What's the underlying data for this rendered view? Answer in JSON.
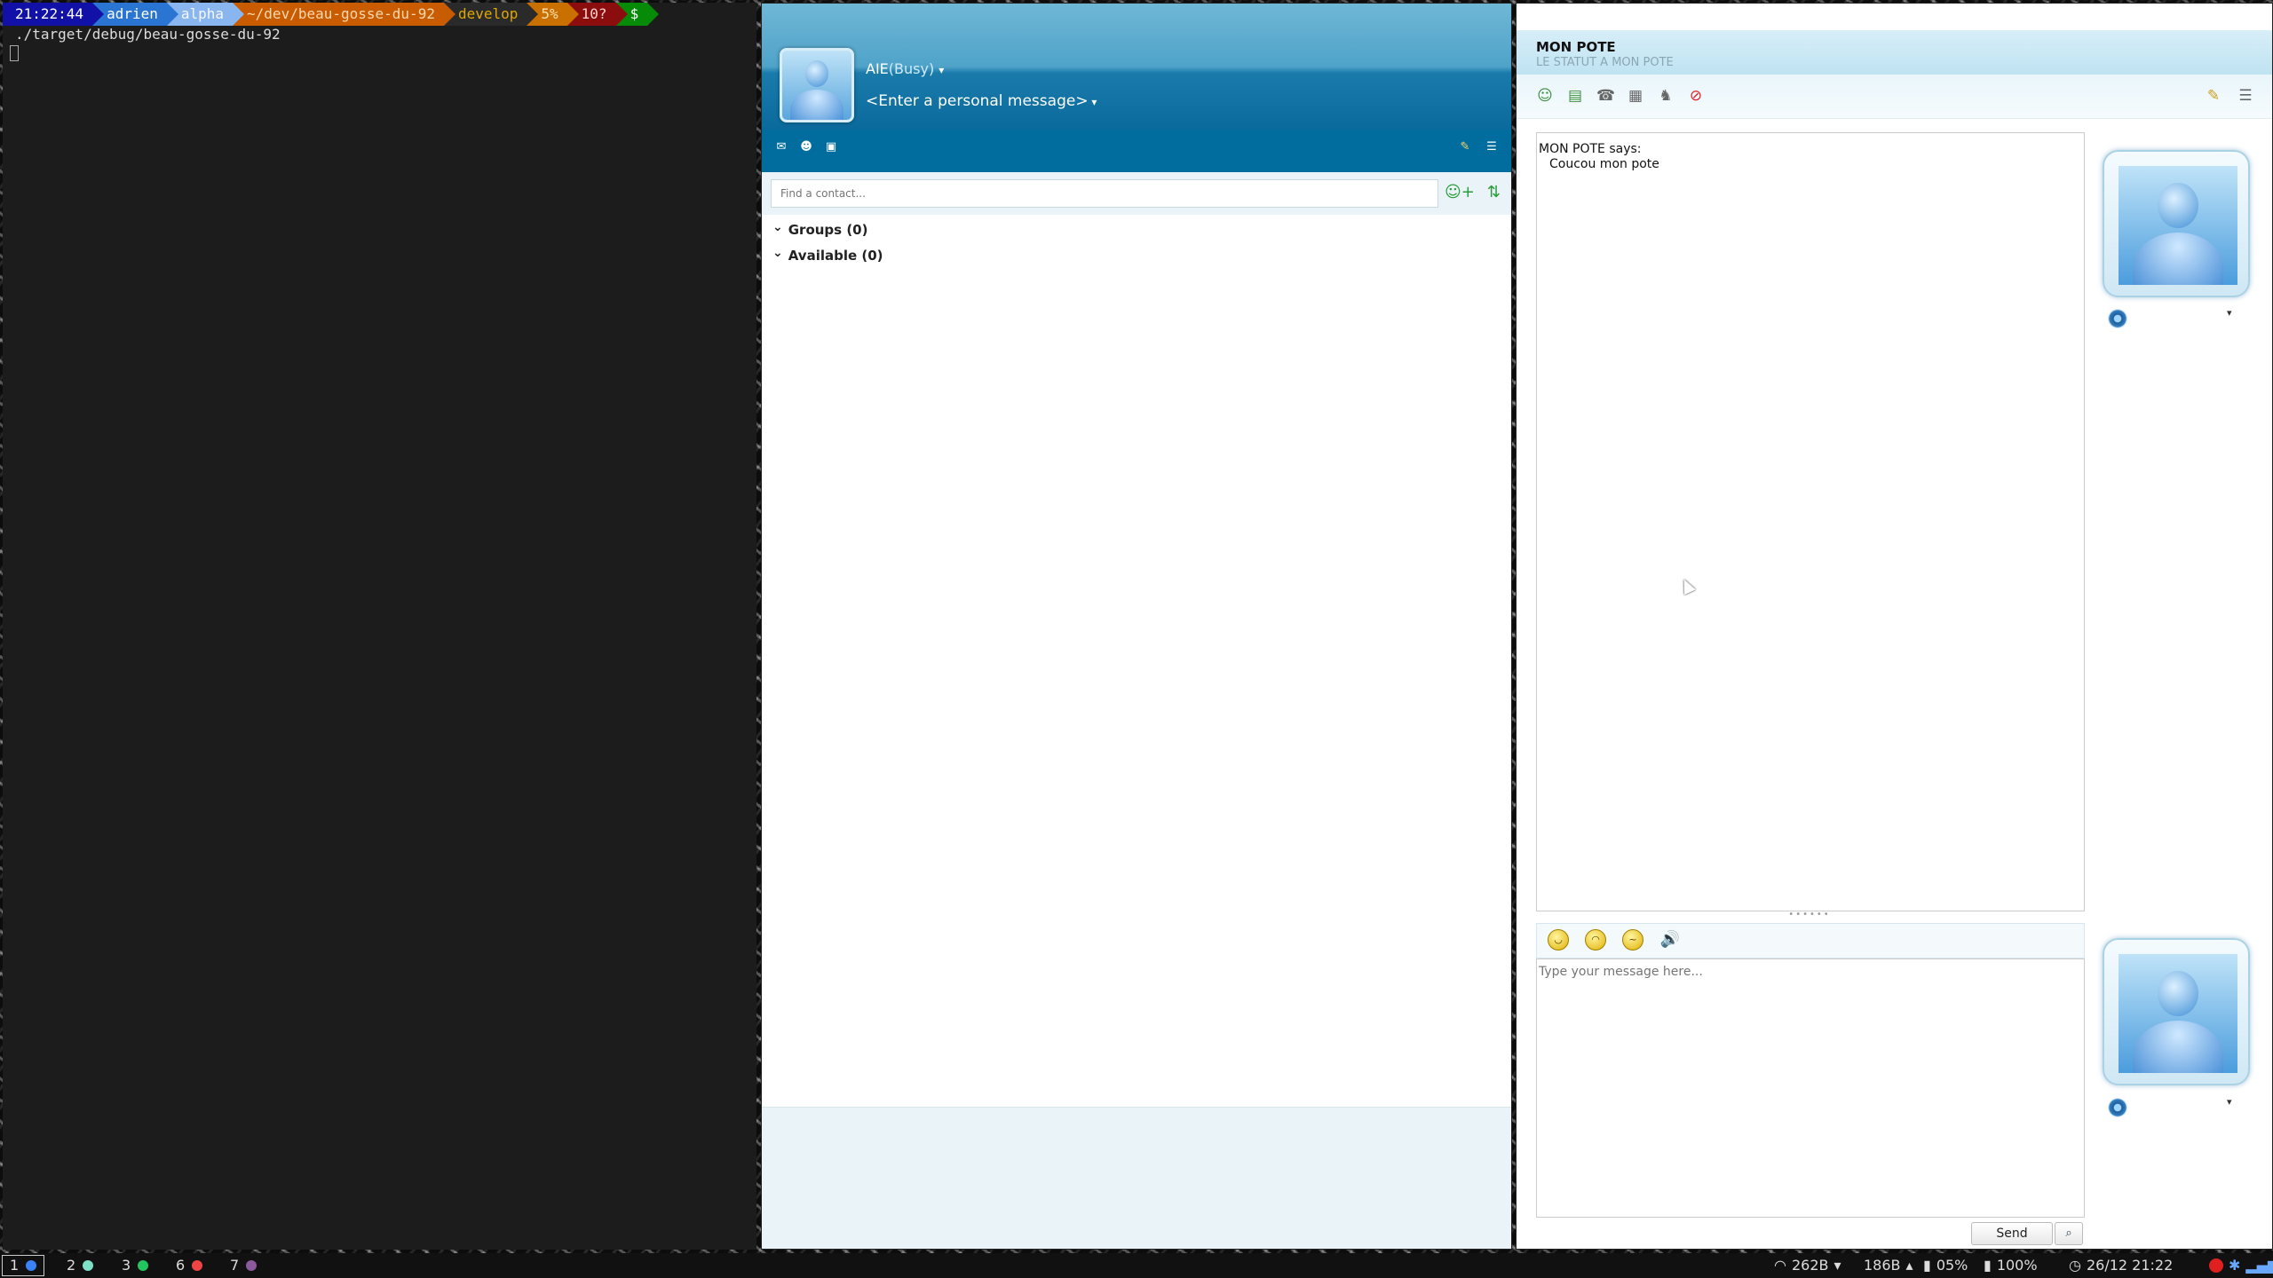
{
  "terminal": {
    "prompt": {
      "time": "21:22:44",
      "user": "adrien",
      "host": "alpha",
      "path": "~/dev/beau-gosse-du-92",
      "branch": "develop",
      "percent": "5%",
      "untracked": "10?",
      "symbol": "$"
    },
    "output_line": "./target/debug/beau-gosse-du-92"
  },
  "contacts": {
    "display_name": "AIE",
    "status": "(Busy)",
    "personal_message": "<Enter a personal message>",
    "search_placeholder": "Find a contact...",
    "groups": [
      {
        "label": "Groups (0)"
      },
      {
        "label": "Available (0)"
      }
    ],
    "toolbar_icons": [
      "mail-icon",
      "contacts-icon",
      "inbox-icon"
    ],
    "toolbar_right_icons": [
      "paintbrush-icon",
      "menu-icon"
    ],
    "search_buttons": [
      "add-contact-icon",
      "sort-icon"
    ]
  },
  "chat": {
    "contact_name": "MON POTE",
    "contact_status": "LE STATUT A MON POTE",
    "history": [
      {
        "sender_line": "MON POTE says:",
        "text": "Coucou mon pote"
      }
    ],
    "compose_placeholder": "Type your message here...",
    "send_label": "Send",
    "toolbar_icons": [
      "invite-icon",
      "share-file-icon",
      "call-icon",
      "video-icon",
      "games-icon",
      "block-icon"
    ],
    "toolbar_right_icons": [
      "paintbrush-icon",
      "menu-icon"
    ],
    "emoticons": [
      "smile-icon",
      "wink-icon",
      "nudge-icon",
      "sound-icon"
    ]
  },
  "taskbar": {
    "workspaces": [
      {
        "num": "1",
        "color": "#3b82f6",
        "active": true
      },
      {
        "num": "2",
        "color": "#7ee0c8",
        "active": false
      },
      {
        "num": "3",
        "color": "#22c55e",
        "active": false
      },
      {
        "num": "6",
        "color": "#ef4444",
        "active": false
      },
      {
        "num": "7",
        "color": "#8b5a9e",
        "active": false
      }
    ],
    "net_down": "262B",
    "net_up": "186B",
    "cpu": "05%",
    "battery": "100%",
    "datetime": "26/12 21:22"
  }
}
